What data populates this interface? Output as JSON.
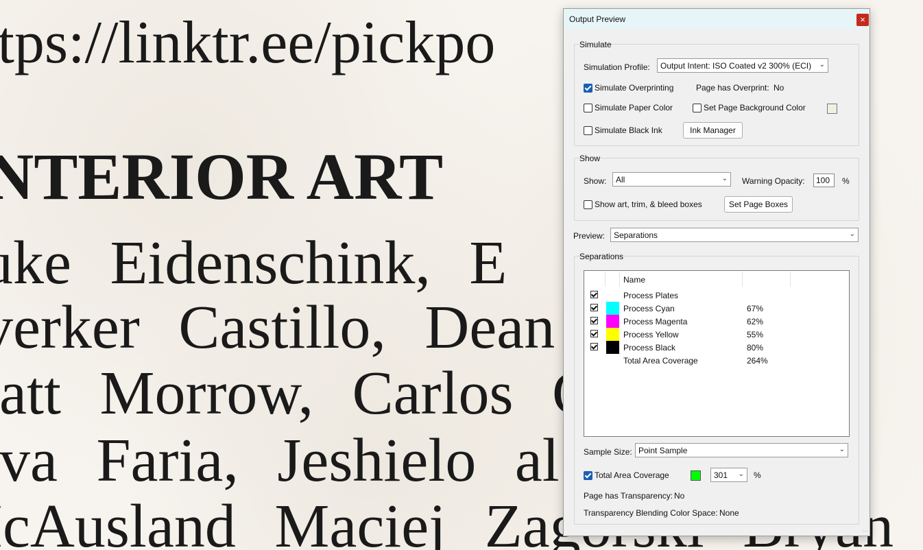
{
  "document": {
    "url_line": "ttps://linktr.ee/pickpo",
    "heading": "NTERIOR ART",
    "lines": [
      "uke Eidenschink, E",
      "verker Castillo, Dean Da",
      "latt Morrow, Carlos C Mar",
      "lva Faria, Jeshielo al",
      "IcAusland Maciej Zagorski Bryan"
    ]
  },
  "dialog": {
    "title": "Output Preview",
    "close_icon": "×",
    "simulate": {
      "title": "Simulate",
      "profile_label": "Simulation Profile:",
      "profile_value": "Output Intent: ISO Coated v2 300% (ECI)",
      "simulate_overprinting": "Simulate Overprinting",
      "page_has_overprint_label": "Page has Overprint:",
      "page_has_overprint_value": "No",
      "simulate_paper_color": "Simulate Paper Color",
      "set_page_bg_color": "Set Page Background Color",
      "simulate_black_ink": "Simulate Black Ink",
      "ink_manager": "Ink Manager"
    },
    "show": {
      "title": "Show",
      "show_label": "Show:",
      "show_value": "All",
      "warning_opacity_label": "Warning Opacity:",
      "warning_opacity_value": "100",
      "percent": "%",
      "show_boxes": "Show art, trim, & bleed boxes",
      "set_page_boxes": "Set Page Boxes"
    },
    "preview": {
      "label": "Preview:",
      "value": "Separations"
    },
    "separations": {
      "title": "Separations",
      "column_name": "Name",
      "rows": [
        {
          "name": "Process Plates",
          "percent": "",
          "color": ""
        },
        {
          "name": "Process Cyan",
          "percent": "67%",
          "color": "#00ffff"
        },
        {
          "name": "Process Magenta",
          "percent": "62%",
          "color": "#ff00ff"
        },
        {
          "name": "Process Yellow",
          "percent": "55%",
          "color": "#ffff00"
        },
        {
          "name": "Process Black",
          "percent": "80%",
          "color": "#000000"
        },
        {
          "name": "Total Area Coverage",
          "percent": "264%",
          "color": ""
        }
      ],
      "sample_size_label": "Sample Size:",
      "sample_size_value": "Point Sample",
      "total_area_coverage": "Total Area Coverage",
      "tac_color": "#00ff00",
      "tac_value": "301",
      "percent": "%",
      "page_has_transparency_label": "Page has Transparency:",
      "page_has_transparency_value": "No",
      "blending_space_label": "Transparency Blending Color Space:",
      "blending_space_value": "None"
    }
  }
}
